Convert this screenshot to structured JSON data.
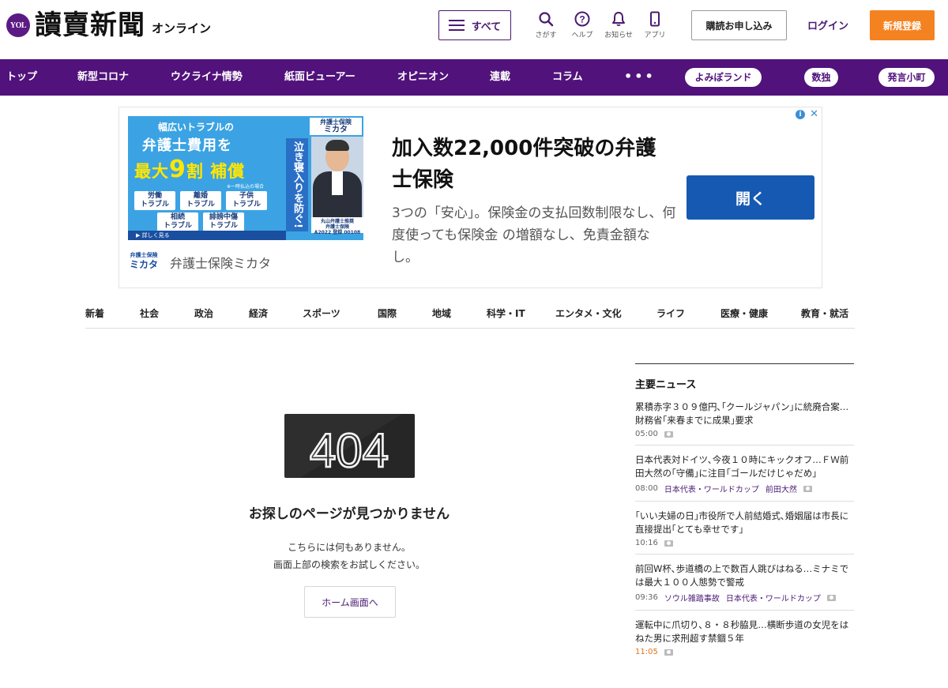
{
  "header": {
    "logo_badge": "YOL",
    "logo_main": "讀賣新聞",
    "logo_sub": "オンライン",
    "menu_label": "すべて",
    "tools": [
      {
        "label": "さがす",
        "icon": "search-icon"
      },
      {
        "label": "ヘルプ",
        "icon": "help-icon"
      },
      {
        "label": "お知らせ",
        "icon": "bell-icon"
      },
      {
        "label": "アプリ",
        "icon": "phone-icon"
      }
    ],
    "subscribe_label": "購読お申し込み",
    "login_label": "ログイン",
    "register_label": "新規登録",
    "brand_color": "#51127b",
    "register_color": "#f58220"
  },
  "nav": {
    "items": [
      "トップ",
      "新型コロナ",
      "ウクライナ情勢",
      "紙面ビューアー",
      "オピニオン",
      "連載",
      "コラム"
    ],
    "more": "•••",
    "pills": [
      "よみぽランド",
      "数独",
      "発言小町"
    ]
  },
  "ad": {
    "image_text": {
      "line1": "幅広いトラブルの",
      "line2": "弁護士費用を",
      "line3_prefix": "最大",
      "line3_num": "9",
      "line3_suffix": "割 補償",
      "note": "※一時払込の場合",
      "tags": [
        "労働\nトラブル",
        "離婚\nトラブル",
        "子供\nトラブル",
        "相続\nトラブル",
        "誹謗中傷\nトラブル"
      ],
      "logo_small": "弁護士保険",
      "logo_name": "ミカタ",
      "vertical": "泣き寝入りを防ぐ!",
      "caption": "丸山弁護士推奨\n弁護士保険\nA2022 登録 00108",
      "more": "▶ 詳しく見る"
    },
    "brand_small": "弁護士保険",
    "brand_logo": "ミカタ",
    "brand_name": "弁護士保険ミカタ",
    "title": "加入数22,000件突破の弁護士保険",
    "description": "3つの「安心」。保険金の支払回数制限なし、何度使っても保険金 の増額なし、免責金額なし。",
    "open_label": "開く",
    "info_label": "i",
    "close_label": "✕"
  },
  "categories": [
    "新着",
    "社会",
    "政治",
    "経済",
    "スポーツ",
    "国際",
    "地域",
    "科学・IT",
    "エンタメ・文化",
    "ライフ",
    "医療・健康",
    "教育・就活"
  ],
  "error": {
    "code": "404",
    "title": "お探しのページが見つかりません",
    "line1": "こちらには何もありません。",
    "line2": "画面上部の検索をお試しください。",
    "home_label": "ホーム画面へ"
  },
  "sidebar": {
    "title": "主要ニュース",
    "items": [
      {
        "headline": "累積赤字３０９億円､｢クールジャパン｣に統廃合案…財務省｢来春までに成果｣要求",
        "time": "05:00",
        "tags": []
      },
      {
        "headline": "日本代表対ドイツ､今夜１０時にキックオフ…ＦＷ前田大然の｢守備｣に注目｢ゴールだけじゃだめ｣",
        "time": "08:00",
        "tags": [
          "日本代表・ワールドカップ",
          "前田大然"
        ]
      },
      {
        "headline": "｢いい夫婦の日｣市役所で人前結婚式､婚姻届は市長に直接提出｢とても幸せです｣",
        "time": "10:16",
        "tags": []
      },
      {
        "headline": "前回W杯､歩道橋の上で数百人跳びはねる…ミナミでは最大１００人態勢で警戒",
        "time": "09:36",
        "tags": [
          "ソウル雑踏事故",
          "日本代表・ワールドカップ"
        ]
      },
      {
        "headline": "運転中に爪切り､８・８秒脇見…横断歩道の女児をはねた男に求刑超す禁錮５年",
        "time": "11:05",
        "tags": []
      }
    ]
  }
}
